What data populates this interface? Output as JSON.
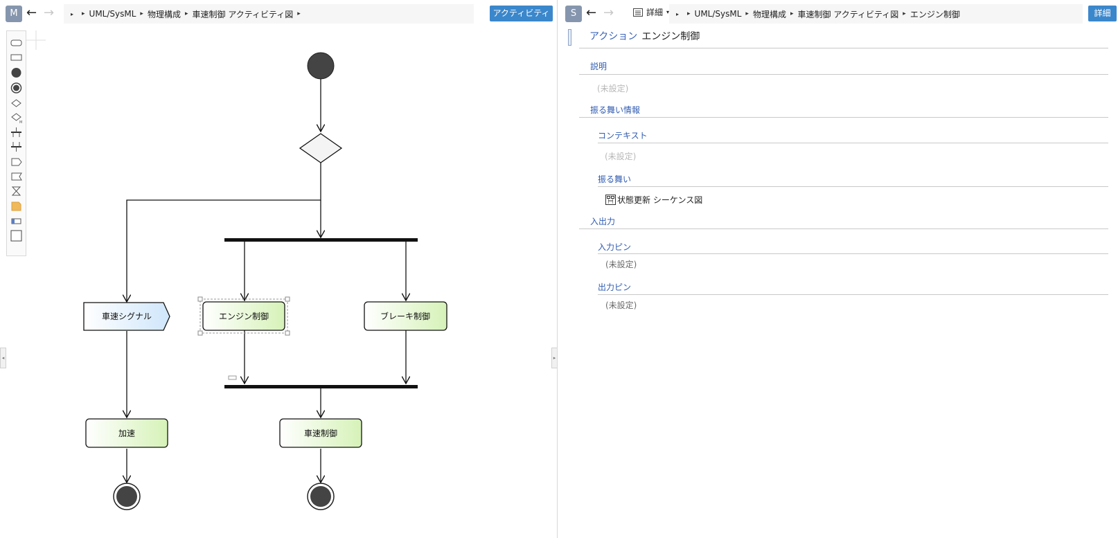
{
  "left": {
    "model_badge": "M",
    "nav": {
      "back_glyph": "←",
      "forward_glyph": "→"
    },
    "breadcrumb": [
      "UML/SysML",
      "物理構成",
      "車速制御 アクティビティ図"
    ],
    "view_button": "アクティビティ図",
    "palette_tools": [
      "action-tool-icon",
      "rectangle-tool-icon",
      "initial-node-tool-icon",
      "final-node-tool-icon",
      "decision-node-tool-icon",
      "merge-node-tool-icon",
      "fork-tool-icon",
      "join-tool-icon",
      "accept-event-tool-icon",
      "send-signal-tool-icon",
      "time-event-tool-icon",
      "note-tool-icon",
      "partition-tool-icon",
      "frame-tool-icon"
    ]
  },
  "diagram": {
    "nodes": {
      "signal": "車速シグナル",
      "engine": "エンジン制御",
      "brake": "ブレーキ制御",
      "accel": "加速",
      "speed": "車速制御"
    }
  },
  "right": {
    "model_badge": "S",
    "nav": {
      "back_glyph": "←",
      "forward_glyph": "→"
    },
    "view_menu": "詳細",
    "breadcrumb": [
      "UML/SysML",
      "物理構成",
      "車速制御 アクティビティ図",
      "エンジン制御"
    ],
    "detail_button": "詳細",
    "title": {
      "kind": "アクション",
      "name": "エンジン制御"
    },
    "sections": {
      "description": {
        "label": "説明",
        "value": "(未設定)"
      },
      "behavior_info": {
        "label": "振る舞い情報",
        "context": {
          "label": "コンテキスト",
          "value": "(未設定)"
        },
        "behavior": {
          "label": "振る舞い",
          "value": "状態更新 シーケンス図"
        }
      },
      "io": {
        "label": "入出力",
        "input_pins": {
          "label": "入力ピン",
          "value": "(未設定)"
        },
        "output_pins": {
          "label": "出力ピン",
          "value": "(未設定)"
        }
      }
    }
  },
  "colors": {
    "accent": "#3b87cc",
    "section": "#2f5bb0",
    "node_fill_start": "#ffffff",
    "node_fill_end": "#d6f2b8",
    "signal_fill": "#d4e9fb"
  }
}
